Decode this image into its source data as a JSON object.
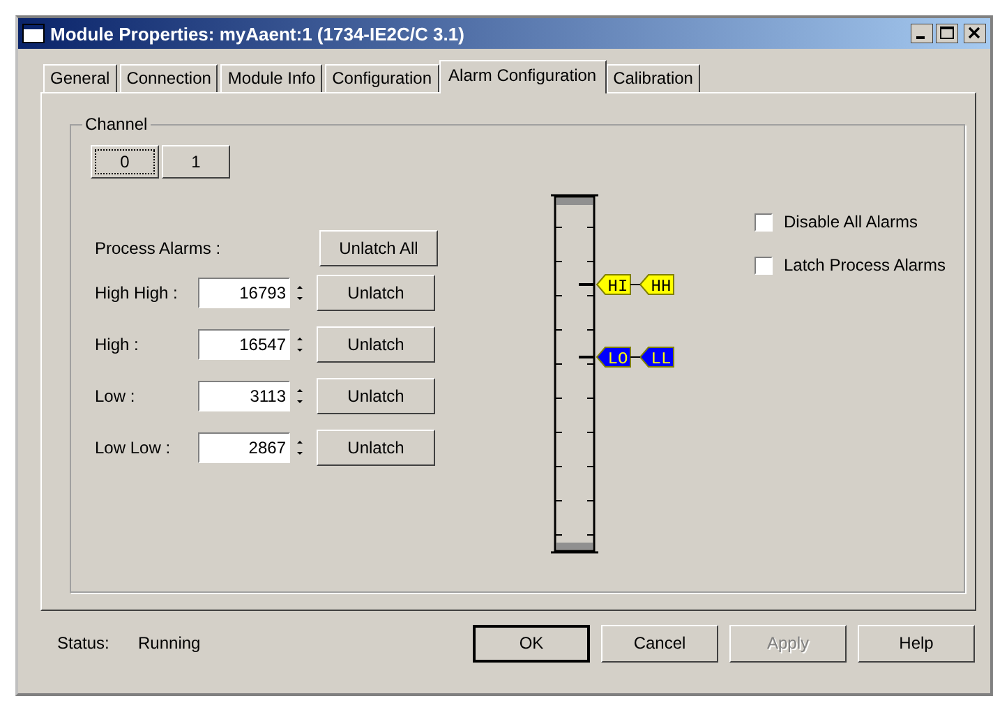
{
  "window": {
    "title": "Module Properties: myAaent:1 (1734-IE2C/C 3.1)"
  },
  "tabs": [
    {
      "label": "General",
      "selected": false
    },
    {
      "label": "Connection",
      "selected": false
    },
    {
      "label": "Module Info",
      "selected": false
    },
    {
      "label": "Configuration",
      "selected": false
    },
    {
      "label": "Alarm Configuration",
      "selected": true
    },
    {
      "label": "Calibration",
      "selected": false
    }
  ],
  "channel_group": {
    "title": "Channel",
    "channels": [
      {
        "label": "0",
        "selected": true
      },
      {
        "label": "1",
        "selected": false
      }
    ]
  },
  "process_alarms": {
    "label": "Process Alarms :",
    "unlatch_all": "Unlatch All",
    "rows": [
      {
        "label": "High High :",
        "value": "16793",
        "button": "Unlatch"
      },
      {
        "label": "High :",
        "value": "16547",
        "button": "Unlatch"
      },
      {
        "label": "Low :",
        "value": "3113",
        "button": "Unlatch"
      },
      {
        "label": "Low Low :",
        "value": "2867",
        "button": "Unlatch"
      }
    ]
  },
  "scale": {
    "rows": [
      {
        "markers": [
          {
            "label": "HI",
            "color": "#ffff00"
          },
          {
            "label": "HH",
            "color": "#ffff00"
          }
        ]
      },
      {
        "markers": [
          {
            "label": "LO",
            "color": "#0000ff"
          },
          {
            "label": "LL",
            "color": "#0000ff"
          }
        ]
      }
    ]
  },
  "options": [
    {
      "label": "Disable All Alarms",
      "checked": false
    },
    {
      "label": "Latch Process Alarms",
      "checked": false
    }
  ],
  "status": {
    "label": "Status:",
    "value": "Running"
  },
  "buttons": [
    {
      "label": "OK",
      "default": true,
      "disabled": false
    },
    {
      "label": "Cancel",
      "default": false,
      "disabled": false
    },
    {
      "label": "Apply",
      "default": false,
      "disabled": true
    },
    {
      "label": "Help",
      "default": false,
      "disabled": false
    }
  ]
}
